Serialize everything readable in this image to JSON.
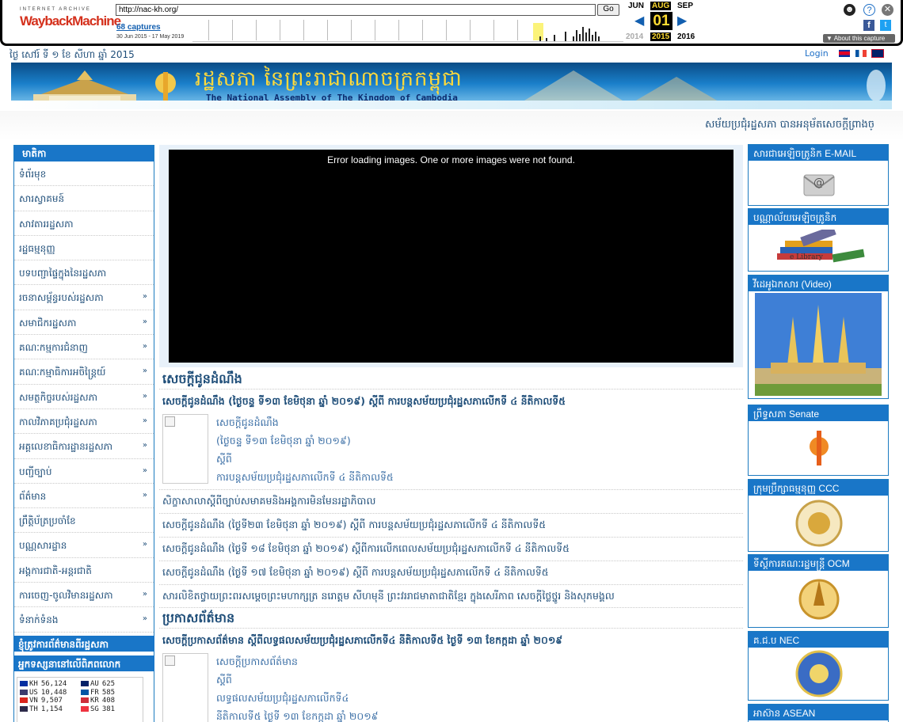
{
  "wayback": {
    "ia_label": "INTERNET ARCHIVE",
    "logo_text": "WaybackMachine",
    "url": "http://nac-kh.org/",
    "go_label": "Go",
    "captures": "68 captures",
    "range": "30 Jun 2015 - 17 May 2019",
    "month_prev": "JUN",
    "month_cur": "AUG",
    "month_next": "SEP",
    "day": "01",
    "year_prev": "2014",
    "year_cur": "2015",
    "year_next": "2016",
    "about": "▼ About this capture",
    "icons": [
      "user-icon",
      "help-icon",
      "close-icon",
      "facebook-icon",
      "twitter-icon"
    ]
  },
  "header": {
    "date": "ថ្ងៃ សៅរ៍ ទី ១ ខែ សីហា ឆ្នាំ 2015",
    "login": "Login",
    "banner_title_km": "រដ្ឋសភា នៃព្រះរាជាណាចក្រកម្ពុជា",
    "banner_title_en": "The National Assembly of The Kingdom of Cambodia",
    "marquee": "សម័យប្រជុំរដ្ឋសភា បានអនុម័តសេចក្តីព្រាងច្"
  },
  "left": {
    "menu_title": "មាតិកា",
    "items": [
      {
        "label": "ទំព័រមុខ",
        "arrow": ""
      },
      {
        "label": "សារស្វាគមន៍",
        "arrow": ""
      },
      {
        "label": "សាវតាររដ្ឋសភា",
        "arrow": ""
      },
      {
        "label": "រដ្ឋធម្មនុញ្ញ",
        "arrow": ""
      },
      {
        "label": "បទបញ្ជាផ្ទៃក្នុងនៃរដ្ឋសភា",
        "arrow": ""
      },
      {
        "label": "រចនាសម្ព័ន្ធរបស់រដ្ឋសភា",
        "arrow": "»"
      },
      {
        "label": "សមាជិករដ្ឋសភា",
        "arrow": "»"
      },
      {
        "label": "គណៈកម្មការជំនាញ",
        "arrow": "»"
      },
      {
        "label": "គណៈកម្មាធិការអចិន្ត្រៃយ៍",
        "arrow": "»"
      },
      {
        "label": "សមត្ថកិច្ចរបស់រដ្ឋសភា",
        "arrow": "»"
      },
      {
        "label": "កាលវិភាគប្រជុំរដ្ឋសភា",
        "arrow": "»"
      },
      {
        "label": "អគ្គលេខាធិការដ្ឋានរដ្ឋសភា",
        "arrow": "»"
      },
      {
        "label": "បញ្ជីច្បាប់",
        "arrow": "»"
      },
      {
        "label": "ព័ត៌មាន",
        "arrow": "»"
      },
      {
        "label": "ព្រឹត្តិប័ត្រប្រចាំខែ",
        "arrow": ""
      },
      {
        "label": "បណ្ណសារដ្ឋាន",
        "arrow": "»"
      },
      {
        "label": "អង្គការជាតិ-អន្តរជាតិ",
        "arrow": ""
      },
      {
        "label": "ការចេញ-ចូលវិមានរដ្ឋសភា",
        "arrow": "»"
      },
      {
        "label": "ទំនាក់ទំនង",
        "arrow": "»"
      }
    ],
    "section2": "ខ្ញុំត្រូវការព័ត៌មានពីរដ្ឋសភា",
    "section3": "អ្នកទស្សនានៅលើពិភពលោក",
    "stats": [
      {
        "cc": "KH",
        "n": "56,124",
        "color": "#032ea1"
      },
      {
        "cc": "US",
        "n": "10,448",
        "color": "#3c3b6e"
      },
      {
        "cc": "VN",
        "n": "9,507",
        "color": "#da251d"
      },
      {
        "cc": "TH",
        "n": "1,154",
        "color": "#2d2a4a"
      },
      {
        "cc": "AU",
        "n": "625",
        "color": "#012169"
      },
      {
        "cc": "FR",
        "n": "585",
        "color": "#0055a4"
      },
      {
        "cc": "KR",
        "n": "408",
        "color": "#cd2e3a"
      },
      {
        "cc": "SG",
        "n": "381",
        "color": "#ef3340"
      }
    ]
  },
  "center": {
    "slider_error": "Error loading images. One or more images were not found.",
    "announce_title": "សេចក្តីជូនដំណឹង",
    "announce_main": "សេចក្តីជូនដំណឹង (ថ្ងៃចន្ទ ទី១៣ ខែមិថុនា ឆ្នាំ ២០១៩) ស្តីពី ការបន្តសម័យប្រជុំរដ្ឋសភាលើកទី ៤ នីតិកាលទី៥",
    "announce_sub": [
      "សេចក្តីជូនដំណឹង",
      "(ថ្ងៃចន្ទ  ទី១៣ ខែមិថុនា ឆ្នាំ ២០១៩)",
      "ស្តីពី",
      "ការបន្តសម័យប្រជុំរដ្ឋសភាលើកទី ៤ នីតិកាលទី៥"
    ],
    "announce_list": [
      "សិក្ខាសាលាស្តីពីច្បាប់សមាគមនិងអង្គការមិនមែនរដ្ឋាភិបាល",
      "សេចក្តីជូនដំណឹង (ថ្ងៃទី២៣ ខែមិថុនា ឆ្នាំ ២០១៩) ស្តីពី ការបន្តសម័យប្រជុំរដ្ឋសភាលើកទី ៤ នីតិកាលទី៥",
      "សេចក្តីជូនដំណឹង (ថ្ងៃទី ១៨ ខែមិថុនា ឆ្នាំ ២០១៩) ស្តីពីការលើកពេលសម័យប្រជុំរដ្ឋសភាលើកទី ៤ នីតិកាលទី៥",
      "សេចក្តីជូនដំណឹង (ថ្ងៃទី ១៧ ខែមិថុនា ឆ្នាំ ២០១៩) ស្តីពី ការបន្តសម័យប្រជុំរដ្ឋសភាលើកទី ៤ នីតិកាលទី៥",
      "សារលិខិតថ្វាយព្រះពរសម្តេចព្រះមហាក្សត្រ នរោត្តម សីហមុនី ព្រះវររាជមាតាជាតិខ្មែរ ក្នុងសេរីភាព សេចក្តីថ្លៃថ្នូរ និងសុភមង្គល"
    ],
    "news_title": "ប្រកាសព័ត៌មាន",
    "news_main": "សេចក្តីប្រកាសព័ត៌មាន ស្តីពីលទ្ធផលសម័យប្រជុំរដ្ឋសភាលើកទី៤ នីតិកាលទី៥ ថ្ងៃទី ១៣ ខែកក្កដា ឆ្នាំ ២០១៩",
    "news_sub": [
      "សេចក្តីប្រកាសព័ត៌មាន",
      "ស្តីពី",
      "លទ្ធផលសម័យប្រជុំរដ្ឋសភាលើកទី៤",
      "នីតិកាលទី៥ ថ្ងៃទី ១៣ ខែកក្កដា ឆ្នាំ ២០១៩"
    ]
  },
  "right": {
    "boxes": [
      {
        "title": "សារជាអេឡិចត្រូនិក E-MAIL"
      },
      {
        "title": "បណ្ណាល័យអេឡិចត្រូនិក",
        "caption": "e Library"
      },
      {
        "title": "វីដេអូឯកសារ (Video)"
      },
      {
        "title": "ព្រឹទ្ធសភា Senate"
      },
      {
        "title": "ក្រុមប្រឹក្សាធម្មនុញ្ញ CCC"
      },
      {
        "title": "ទីស្តីការគណៈរដ្ឋមន្ត្រី OCM"
      },
      {
        "title": "គ.ជ.ប NEC"
      },
      {
        "title": "អាស៊ាន ASEAN"
      }
    ]
  },
  "colors": {
    "accent": "#1976c8",
    "text": "#1f4e79"
  }
}
